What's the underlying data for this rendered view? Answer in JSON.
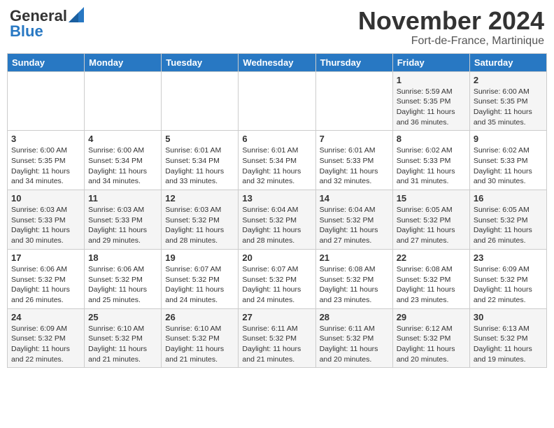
{
  "header": {
    "logo_line1": "General",
    "logo_line2": "Blue",
    "month": "November 2024",
    "location": "Fort-de-France, Martinique"
  },
  "weekdays": [
    "Sunday",
    "Monday",
    "Tuesday",
    "Wednesday",
    "Thursday",
    "Friday",
    "Saturday"
  ],
  "weeks": [
    [
      {
        "day": "",
        "info": ""
      },
      {
        "day": "",
        "info": ""
      },
      {
        "day": "",
        "info": ""
      },
      {
        "day": "",
        "info": ""
      },
      {
        "day": "",
        "info": ""
      },
      {
        "day": "1",
        "info": "Sunrise: 5:59 AM\nSunset: 5:35 PM\nDaylight: 11 hours and 36 minutes."
      },
      {
        "day": "2",
        "info": "Sunrise: 6:00 AM\nSunset: 5:35 PM\nDaylight: 11 hours and 35 minutes."
      }
    ],
    [
      {
        "day": "3",
        "info": "Sunrise: 6:00 AM\nSunset: 5:35 PM\nDaylight: 11 hours and 34 minutes."
      },
      {
        "day": "4",
        "info": "Sunrise: 6:00 AM\nSunset: 5:34 PM\nDaylight: 11 hours and 34 minutes."
      },
      {
        "day": "5",
        "info": "Sunrise: 6:01 AM\nSunset: 5:34 PM\nDaylight: 11 hours and 33 minutes."
      },
      {
        "day": "6",
        "info": "Sunrise: 6:01 AM\nSunset: 5:34 PM\nDaylight: 11 hours and 32 minutes."
      },
      {
        "day": "7",
        "info": "Sunrise: 6:01 AM\nSunset: 5:33 PM\nDaylight: 11 hours and 32 minutes."
      },
      {
        "day": "8",
        "info": "Sunrise: 6:02 AM\nSunset: 5:33 PM\nDaylight: 11 hours and 31 minutes."
      },
      {
        "day": "9",
        "info": "Sunrise: 6:02 AM\nSunset: 5:33 PM\nDaylight: 11 hours and 30 minutes."
      }
    ],
    [
      {
        "day": "10",
        "info": "Sunrise: 6:03 AM\nSunset: 5:33 PM\nDaylight: 11 hours and 30 minutes."
      },
      {
        "day": "11",
        "info": "Sunrise: 6:03 AM\nSunset: 5:33 PM\nDaylight: 11 hours and 29 minutes."
      },
      {
        "day": "12",
        "info": "Sunrise: 6:03 AM\nSunset: 5:32 PM\nDaylight: 11 hours and 28 minutes."
      },
      {
        "day": "13",
        "info": "Sunrise: 6:04 AM\nSunset: 5:32 PM\nDaylight: 11 hours and 28 minutes."
      },
      {
        "day": "14",
        "info": "Sunrise: 6:04 AM\nSunset: 5:32 PM\nDaylight: 11 hours and 27 minutes."
      },
      {
        "day": "15",
        "info": "Sunrise: 6:05 AM\nSunset: 5:32 PM\nDaylight: 11 hours and 27 minutes."
      },
      {
        "day": "16",
        "info": "Sunrise: 6:05 AM\nSunset: 5:32 PM\nDaylight: 11 hours and 26 minutes."
      }
    ],
    [
      {
        "day": "17",
        "info": "Sunrise: 6:06 AM\nSunset: 5:32 PM\nDaylight: 11 hours and 26 minutes."
      },
      {
        "day": "18",
        "info": "Sunrise: 6:06 AM\nSunset: 5:32 PM\nDaylight: 11 hours and 25 minutes."
      },
      {
        "day": "19",
        "info": "Sunrise: 6:07 AM\nSunset: 5:32 PM\nDaylight: 11 hours and 24 minutes."
      },
      {
        "day": "20",
        "info": "Sunrise: 6:07 AM\nSunset: 5:32 PM\nDaylight: 11 hours and 24 minutes."
      },
      {
        "day": "21",
        "info": "Sunrise: 6:08 AM\nSunset: 5:32 PM\nDaylight: 11 hours and 23 minutes."
      },
      {
        "day": "22",
        "info": "Sunrise: 6:08 AM\nSunset: 5:32 PM\nDaylight: 11 hours and 23 minutes."
      },
      {
        "day": "23",
        "info": "Sunrise: 6:09 AM\nSunset: 5:32 PM\nDaylight: 11 hours and 22 minutes."
      }
    ],
    [
      {
        "day": "24",
        "info": "Sunrise: 6:09 AM\nSunset: 5:32 PM\nDaylight: 11 hours and 22 minutes."
      },
      {
        "day": "25",
        "info": "Sunrise: 6:10 AM\nSunset: 5:32 PM\nDaylight: 11 hours and 21 minutes."
      },
      {
        "day": "26",
        "info": "Sunrise: 6:10 AM\nSunset: 5:32 PM\nDaylight: 11 hours and 21 minutes."
      },
      {
        "day": "27",
        "info": "Sunrise: 6:11 AM\nSunset: 5:32 PM\nDaylight: 11 hours and 21 minutes."
      },
      {
        "day": "28",
        "info": "Sunrise: 6:11 AM\nSunset: 5:32 PM\nDaylight: 11 hours and 20 minutes."
      },
      {
        "day": "29",
        "info": "Sunrise: 6:12 AM\nSunset: 5:32 PM\nDaylight: 11 hours and 20 minutes."
      },
      {
        "day": "30",
        "info": "Sunrise: 6:13 AM\nSunset: 5:32 PM\nDaylight: 11 hours and 19 minutes."
      }
    ]
  ]
}
